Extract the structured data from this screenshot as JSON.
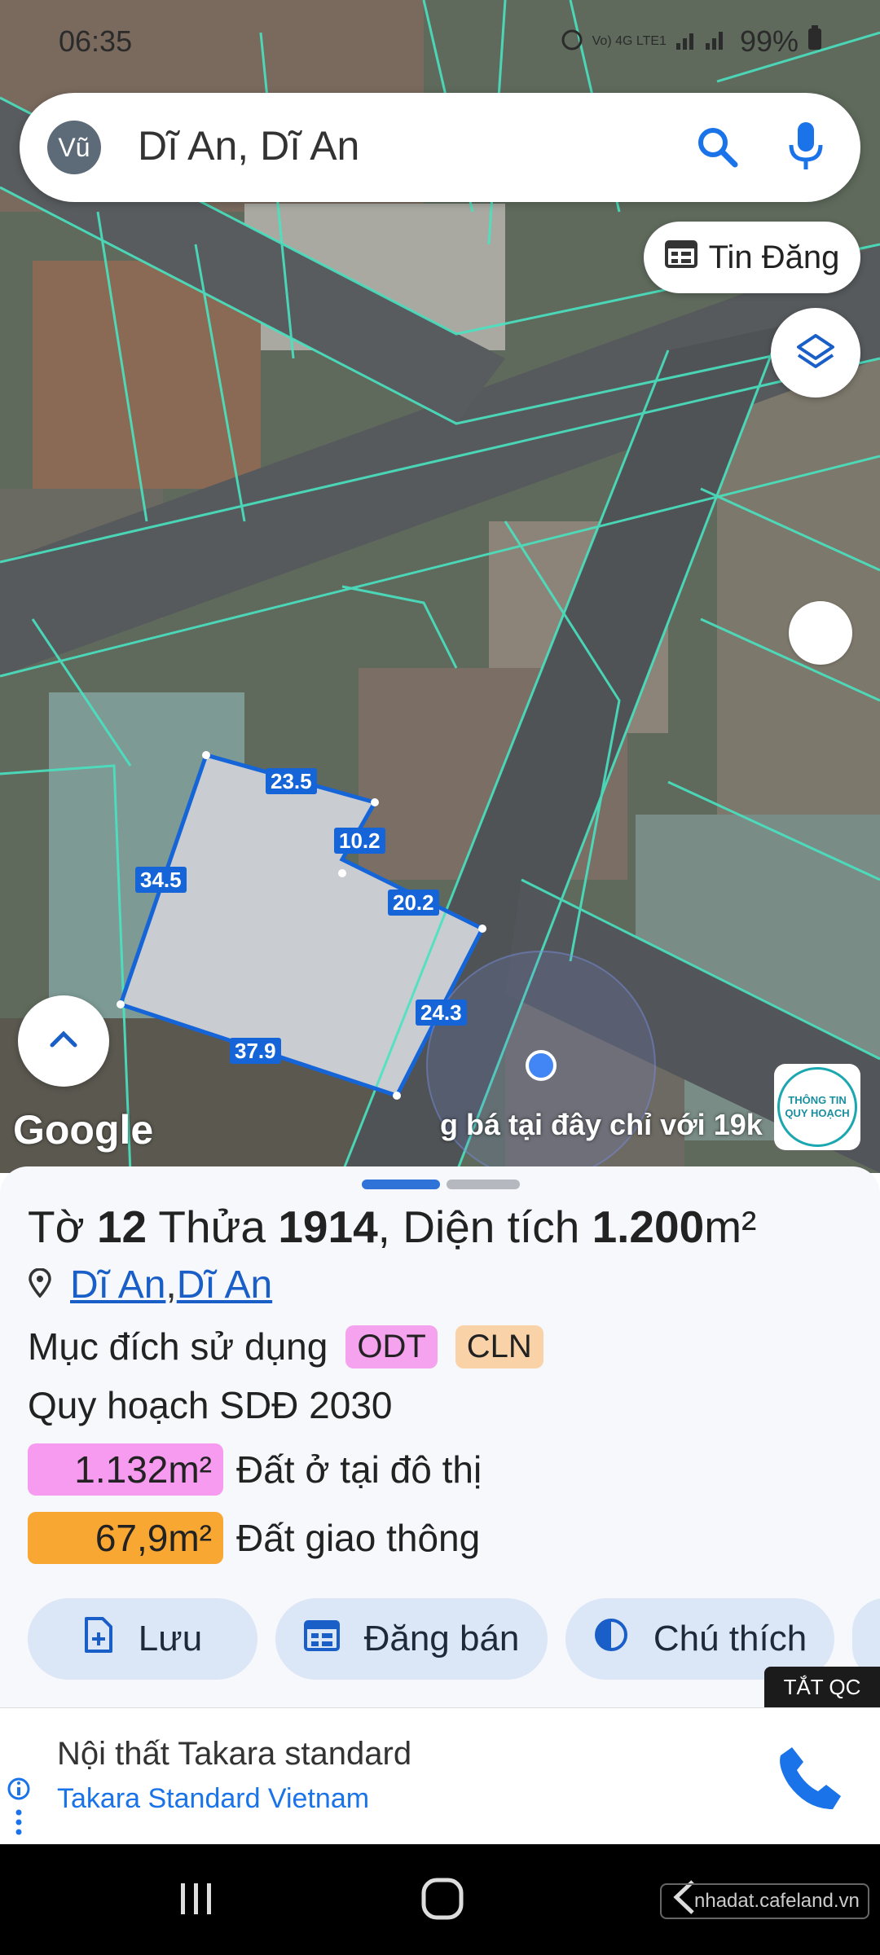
{
  "status_bar": {
    "time": "06:35",
    "signal": "Vo) 4G LTE1",
    "battery": "99%"
  },
  "search": {
    "avatar_initials": "Vũ",
    "query": "Dĩ An, Dĩ An"
  },
  "map": {
    "tin_dang_label": "Tin Đăng",
    "google_label": "Google",
    "ad_ticker": "g bá tại đây chỉ với 19k",
    "quy_hoach_badge_line1": "THÔNG TIN",
    "quy_hoach_badge_line2": "QUY HOẠCH",
    "measurements": [
      "23.5",
      "10.2",
      "34.5",
      "20.2",
      "24.3",
      "37.9"
    ]
  },
  "sheet": {
    "title_to": "Tờ ",
    "title_to_num": "12",
    "title_thua": " Thửa ",
    "title_thua_num": "1914",
    "title_dt": ", Diện tích ",
    "title_dt_num": "1.200",
    "title_unit": "m²",
    "location_part1": "Dĩ An",
    "location_sep": ", ",
    "location_part2": "Dĩ An",
    "purpose_label": "Mục đích sử dụng",
    "tags": [
      {
        "text": "ODT",
        "color": "#f5a3ef"
      },
      {
        "text": "CLN",
        "color": "#fad2a8"
      }
    ],
    "plan_label": "Quy hoạch SDĐ 2030",
    "areas": [
      {
        "value": "1.132m²",
        "label": "Đất ở tại đô thị",
        "color": "#f79bf0"
      },
      {
        "value": "67,9m²",
        "label": "Đất giao thông",
        "color": "#f8a733"
      }
    ],
    "actions": [
      {
        "label": "Lưu",
        "icon": "file-add-icon"
      },
      {
        "label": "Đăng bán",
        "icon": "calendar-list-icon"
      },
      {
        "label": "Chú thích",
        "icon": "contrast-icon"
      }
    ],
    "tat_qc": "TẮT QC"
  },
  "ad": {
    "title": "Nội thất Takara standard",
    "subtitle": "Takara Standard Vietnam"
  },
  "nav": {
    "watermark": "nhadat.cafeland.vn"
  }
}
